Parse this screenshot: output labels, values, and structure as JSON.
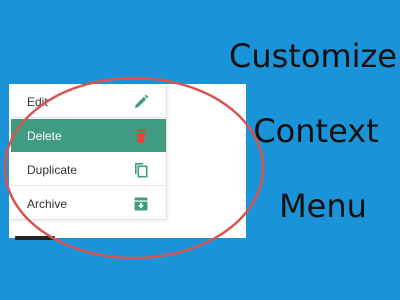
{
  "menu": {
    "items": [
      {
        "label": "Edit",
        "icon": "pencil-icon"
      },
      {
        "label": "Delete",
        "icon": "trash-icon",
        "highlighted": true
      },
      {
        "label": "Duplicate",
        "icon": "copy-icon"
      },
      {
        "label": "Archive",
        "icon": "archive-icon"
      }
    ],
    "highlight_color": "#3f9c83",
    "icon_color": "#3f9c83",
    "delete_icon_color": "#e0473a"
  },
  "headline": {
    "line1": "Customize",
    "line2": "Context",
    "line3": "Menu"
  },
  "colors": {
    "background": "#1b93d8",
    "ellipse": "#d9534f"
  }
}
